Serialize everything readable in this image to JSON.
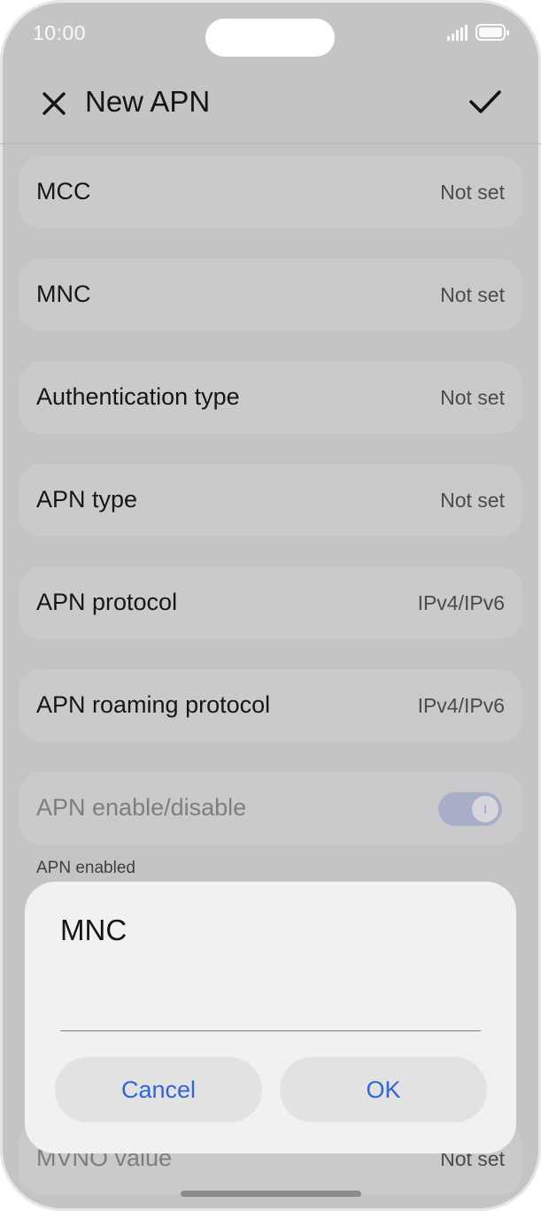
{
  "status_bar": {
    "time": "10:00"
  },
  "appbar": {
    "title": "New APN"
  },
  "rows": [
    {
      "label": "MCC",
      "value": "Not set"
    },
    {
      "label": "MNC",
      "value": "Not set"
    },
    {
      "label": "Authentication type",
      "value": "Not set"
    },
    {
      "label": "APN type",
      "value": "Not set"
    },
    {
      "label": "APN protocol",
      "value": "IPv4/IPv6"
    },
    {
      "label": "APN roaming protocol",
      "value": "IPv4/IPv6"
    },
    {
      "label": "APN enable/disable",
      "toggle_on": true
    }
  ],
  "apn_caption": "APN enabled",
  "bottom_row": {
    "label": "MVNO value",
    "value": "Not set"
  },
  "dialog": {
    "title": "MNC",
    "input_value": "",
    "cancel_label": "Cancel",
    "ok_label": "OK"
  },
  "colors": {
    "accent": "#2f66d6",
    "scrim_background": "#c4c4c6",
    "dialog_background": "#f1f1f1"
  }
}
